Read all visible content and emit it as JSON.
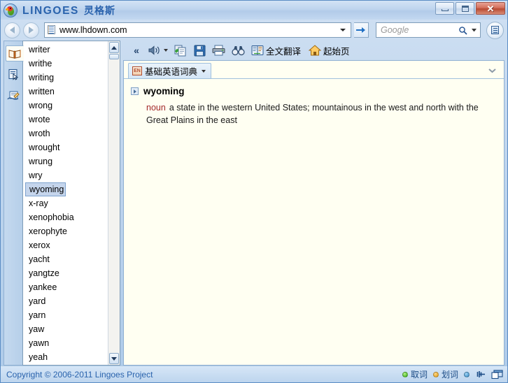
{
  "window": {
    "title_en": "LINGOES",
    "title_cn": "灵格斯",
    "app_icon": "parrot-logo",
    "controls": {
      "minimize": "minimize-button",
      "maximize": "maximize-button",
      "close": "close-button",
      "close_glyph": "✕"
    }
  },
  "address_bar": {
    "back": "back-button",
    "forward": "forward-button",
    "url_icon": "page-list-icon",
    "url_value": "www.lhdown.com",
    "url_placeholder": "",
    "dropdown": "history-dropdown",
    "go": "go-button",
    "search_placeholder": "Google",
    "search_value": "",
    "search_icon": "magnifier-icon",
    "search_dropdown": "search-engine-dropdown",
    "menu_button": "app-menu-button"
  },
  "rail": {
    "items": [
      {
        "name": "dictionary",
        "icon": "open-book-icon",
        "active": true
      },
      {
        "name": "text-capture",
        "icon": "document-cursor-icon",
        "active": false
      },
      {
        "name": "appendix",
        "icon": "hand-writing-icon",
        "active": false
      }
    ]
  },
  "wordlist": {
    "selected": "wyoming",
    "items": [
      "writer",
      "writhe",
      "writing",
      "written",
      "wrong",
      "wrote",
      "wroth",
      "wrought",
      "wrung",
      "wry",
      "wyoming",
      "x-ray",
      "xenophobia",
      "xerophyte",
      "xerox",
      "yacht",
      "yangtze",
      "yankee",
      "yard",
      "yarn",
      "yaw",
      "yawn",
      "yeah"
    ],
    "scroll_up": "scroll-up-button",
    "scroll_down": "scroll-down-button"
  },
  "toolbar": {
    "collapse": "«",
    "items": [
      {
        "name": "pronounce",
        "icon": "speaker-icon",
        "label": "",
        "has_caret": true
      },
      {
        "name": "copy",
        "icon": "copy-icon",
        "label": "",
        "has_caret": false
      },
      {
        "name": "save",
        "icon": "save-icon",
        "label": "",
        "has_caret": false
      },
      {
        "name": "print",
        "icon": "printer-icon",
        "label": "",
        "has_caret": false
      },
      {
        "name": "find",
        "icon": "binoculars-icon",
        "label": "",
        "has_caret": false
      },
      {
        "name": "translate",
        "icon": "translate-icon",
        "label": "全文翻译",
        "has_caret": false
      },
      {
        "name": "home",
        "icon": "home-icon",
        "label": "起始页",
        "has_caret": false
      }
    ]
  },
  "dictionary_tab": {
    "icon": "en-dictionary-icon",
    "icon_text": "EN",
    "label": "基础英语词典",
    "chevron": "❯"
  },
  "entry": {
    "headword": "wyoming",
    "part_of_speech": "noun",
    "definition": "a state in the western United States; mountainous in the west and north with the Great Plains in the east"
  },
  "status_bar": {
    "copyright": "Copyright © 2006-2011 Lingoes Project",
    "indicators": [
      {
        "name": "capture-word",
        "label": "取词",
        "color": "green"
      },
      {
        "name": "select-word",
        "label": "划词",
        "color": "orange"
      },
      {
        "name": "extra-state",
        "label": "",
        "color": "blue"
      }
    ],
    "pin": "pin-icon",
    "window_mode": "window-mode-icon"
  },
  "colors": {
    "brand": "#2a63ad",
    "content_bg": "#fffff2",
    "selection": "#c5d5ec",
    "pos_red": "#a32a2a"
  }
}
